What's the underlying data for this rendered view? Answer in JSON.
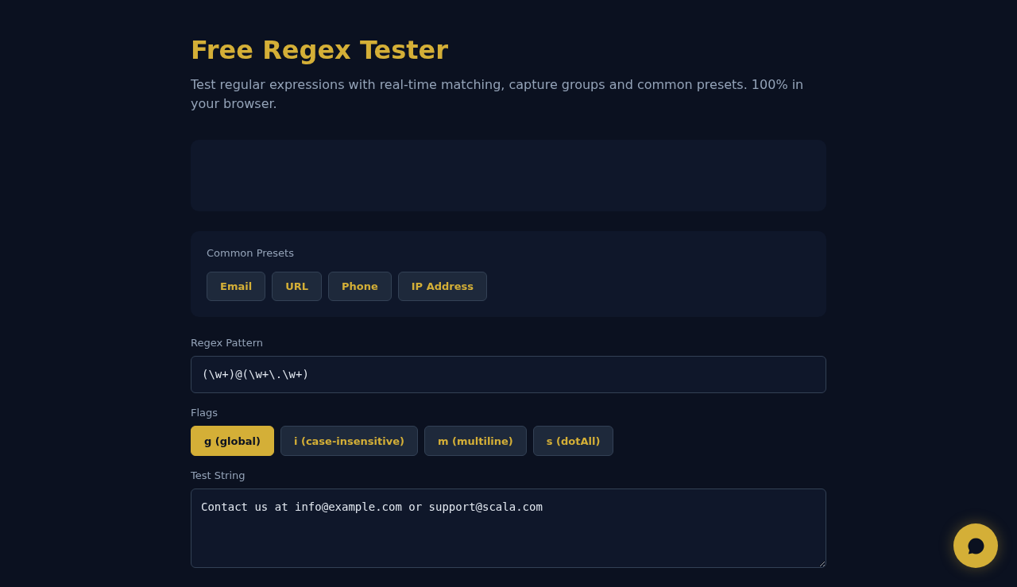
{
  "header": {
    "title": "Free Regex Tester",
    "subtitle": "Test regular expressions with real-time matching, capture groups and common presets. 100% in your browser."
  },
  "presets": {
    "label": "Common Presets",
    "items": [
      "Email",
      "URL",
      "Phone",
      "IP Address"
    ]
  },
  "pattern": {
    "label": "Regex Pattern",
    "value": "(\\w+)@(\\w+\\.\\w+)"
  },
  "flags": {
    "label": "Flags",
    "items": [
      {
        "label": "g (global)",
        "selected": true
      },
      {
        "label": "i (case-insensitive)",
        "selected": false
      },
      {
        "label": "m (multiline)",
        "selected": false
      },
      {
        "label": "s (dotAll)",
        "selected": false
      }
    ]
  },
  "test_string": {
    "label": "Test String",
    "value": "Contact us at info@example.com or support@scala.com"
  }
}
